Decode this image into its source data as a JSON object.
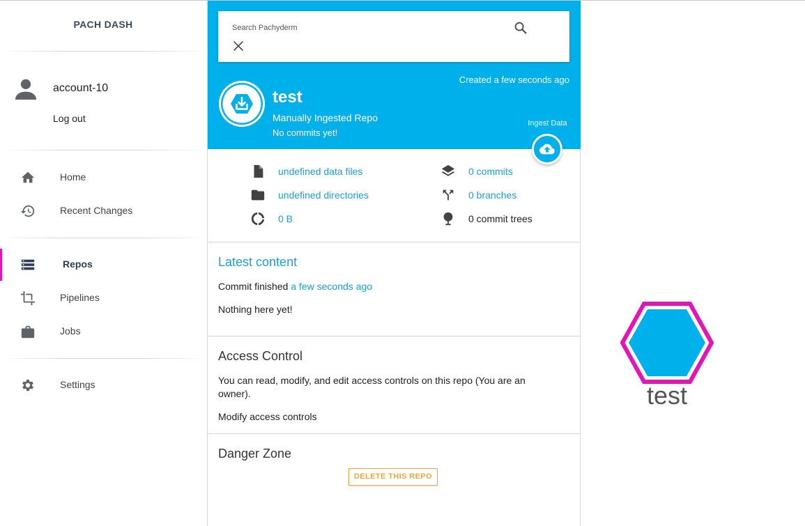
{
  "app": {
    "brand": "PACH DASH"
  },
  "account": {
    "name": "account-10",
    "logout_label": "Log out"
  },
  "sidebar": {
    "items": [
      {
        "label": "Home",
        "icon": "home-icon"
      },
      {
        "label": "Recent Changes",
        "icon": "history-icon"
      },
      {
        "label": "Repos",
        "icon": "list-icon",
        "active": true
      },
      {
        "label": "Pipelines",
        "icon": "crop-icon"
      },
      {
        "label": "Jobs",
        "icon": "briefcase-icon"
      },
      {
        "label": "Settings",
        "icon": "gear-icon"
      }
    ]
  },
  "search": {
    "label": "Search Pachyderm"
  },
  "repo": {
    "name": "test",
    "type": "Manually Ingested Repo",
    "commit_status": "No commits yet!",
    "created": "Created a few seconds ago",
    "ingest_label": "Ingest Data"
  },
  "stats": {
    "data_files": "undefined data files",
    "directories": "undefined directories",
    "size": "0 B",
    "commits": "0 commits",
    "branches": "0 branches",
    "commit_trees": "0 commit trees"
  },
  "latest": {
    "title": "Latest content",
    "commit_prefix": "Commit finished",
    "commit_time": "a few seconds ago",
    "empty": "Nothing here yet!"
  },
  "access": {
    "title": "Access Control",
    "body": "You can read, modify, and edit access controls on this repo (You are an owner).",
    "link": "Modify access controls"
  },
  "danger": {
    "title": "Danger Zone",
    "delete_label": "DELETE THIS REPO"
  },
  "graph": {
    "node_label": "test"
  },
  "colors": {
    "accent": "#00b0ea",
    "link": "#1a9fd8",
    "active_marker": "#e514b5",
    "danger": "#f0a63a"
  }
}
